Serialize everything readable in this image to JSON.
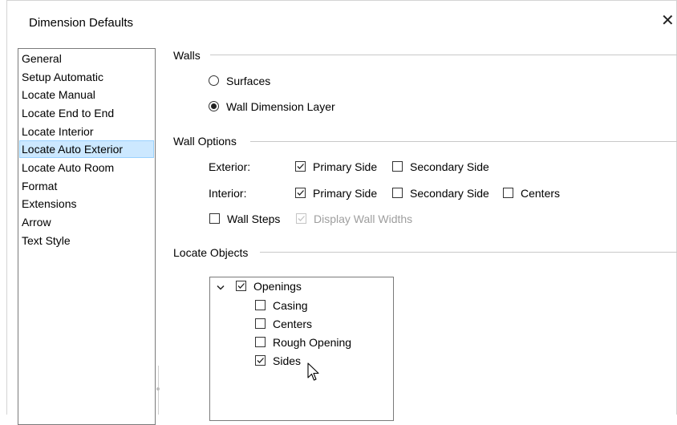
{
  "window": {
    "title": "Dimension Defaults",
    "close_icon": "close-icon",
    "close_symbol": "✕"
  },
  "sidebar": {
    "items": [
      {
        "label": "General",
        "selected": false
      },
      {
        "label": "Setup Automatic",
        "selected": false
      },
      {
        "label": "Locate Manual",
        "selected": false
      },
      {
        "label": "Locate End to End",
        "selected": false
      },
      {
        "label": "Locate Interior",
        "selected": false
      },
      {
        "label": "Locate Auto Exterior",
        "selected": true
      },
      {
        "label": "Locate Auto Room",
        "selected": false
      },
      {
        "label": "Format",
        "selected": false
      },
      {
        "label": "Extensions",
        "selected": false
      },
      {
        "label": "Arrow",
        "selected": false
      },
      {
        "label": "Text Style",
        "selected": false
      }
    ]
  },
  "walls": {
    "header": "Walls",
    "options": [
      {
        "label": "Surfaces",
        "selected": false
      },
      {
        "label": "Wall Dimension Layer",
        "selected": true
      }
    ]
  },
  "wall_options": {
    "header": "Wall Options",
    "exterior": {
      "label": "Exterior:",
      "primary_side": {
        "label": "Primary Side",
        "checked": true
      },
      "secondary_side": {
        "label": "Secondary Side",
        "checked": false
      }
    },
    "interior": {
      "label": "Interior:",
      "primary_side": {
        "label": "Primary Side",
        "checked": true
      },
      "secondary_side": {
        "label": "Secondary Side",
        "checked": false
      },
      "centers": {
        "label": "Centers",
        "checked": false
      }
    },
    "wall_steps": {
      "label": "Wall Steps",
      "checked": false
    },
    "display_wall_widths": {
      "label": "Display Wall Widths",
      "checked": true,
      "disabled": true
    }
  },
  "locate_objects": {
    "header": "Locate Objects",
    "tree": {
      "root": {
        "label": "Openings",
        "checked": true,
        "expanded": true,
        "expander_icon": "chevron-down-icon"
      },
      "children": [
        {
          "label": "Casing",
          "checked": false
        },
        {
          "label": "Centers",
          "checked": false
        },
        {
          "label": "Rough Opening",
          "checked": false
        },
        {
          "label": "Sides",
          "checked": true
        }
      ]
    }
  },
  "cursor": {
    "icon": "mouse-pointer-icon"
  },
  "colors": {
    "selection_bg": "#cce8ff",
    "selection_border": "#99d1ff",
    "disabled_text": "#9e9e9e",
    "border": "#7a7a7a"
  }
}
